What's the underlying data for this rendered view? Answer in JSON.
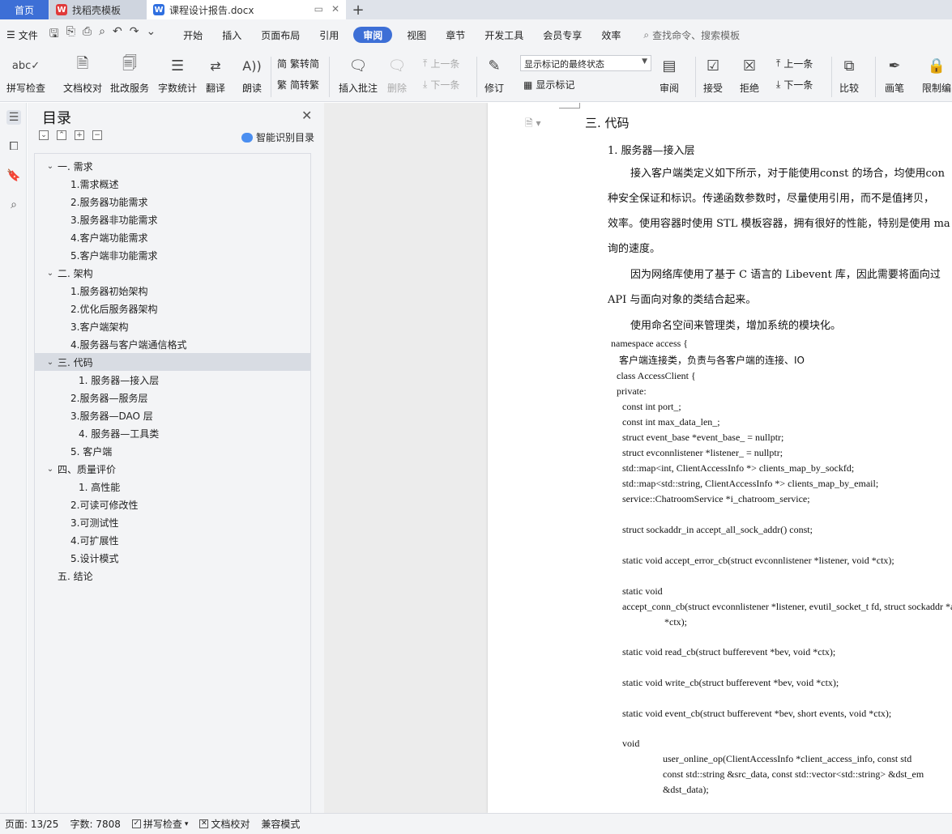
{
  "tabs": {
    "home": "首页",
    "template": "找稻壳模板",
    "doc": "课程设计报告.docx"
  },
  "menu": {
    "file": "文件",
    "items": [
      "开始",
      "插入",
      "页面布局",
      "引用",
      "审阅",
      "视图",
      "章节",
      "开发工具",
      "会员专享",
      "效率"
    ],
    "active_index": 4,
    "search": "查找命令、搜索模板"
  },
  "ribbon": {
    "spell": "拼写检查",
    "doc_check": "文档校对",
    "batch": "批改服务",
    "word_count": "字数统计",
    "translate": "翻译",
    "read_aloud": "朗读",
    "trad_to_simp": "繁转简",
    "simp_to_trad": "简转繁",
    "insert_comment": "插入批注",
    "delete": "删除",
    "prev": "上一条",
    "next": "下一条",
    "revise": "修订",
    "markup_select": "显示标记的最终状态",
    "show_markup": "显示标记",
    "review": "审阅",
    "accept": "接受",
    "reject": "拒绝",
    "prev2": "上一条",
    "next2": "下一条",
    "compare": "比较",
    "pen": "画笔",
    "restrict": "限制编"
  },
  "toc": {
    "title": "目录",
    "smart": "智能识别目录",
    "items": [
      {
        "label": "一. 需求",
        "level": 1,
        "chev": true
      },
      {
        "label": "1.需求概述",
        "level": 2
      },
      {
        "label": "2.服务器功能需求",
        "level": 2
      },
      {
        "label": "3.服务器非功能需求",
        "level": 2
      },
      {
        "label": "4.客户端功能需求",
        "level": 2
      },
      {
        "label": "5.客户端非功能需求",
        "level": 2
      },
      {
        "label": "二. 架构",
        "level": 1,
        "chev": true
      },
      {
        "label": "1.服务器初始架构",
        "level": 2
      },
      {
        "label": "2.优化后服务器架构",
        "level": 2
      },
      {
        "label": "3.客户端架构",
        "level": 2
      },
      {
        "label": "4.服务器与客户端通信格式",
        "level": 2
      },
      {
        "label": "三. 代码",
        "level": 1,
        "chev": true,
        "selected": true
      },
      {
        "label": "1. 服务器—接入层",
        "level": 3
      },
      {
        "label": "2.服务器—服务层",
        "level": 2
      },
      {
        "label": "3.服务器—DAO 层",
        "level": 2
      },
      {
        "label": "4. 服务器—工具类",
        "level": 3
      },
      {
        "label": "5. 客户端",
        "level": 2
      },
      {
        "label": "四、质量评价",
        "level": 1,
        "chev": true
      },
      {
        "label": "1. 高性能",
        "level": 3
      },
      {
        "label": "2.可读可修改性",
        "level": 2
      },
      {
        "label": "3.可测试性",
        "level": 2
      },
      {
        "label": "4.可扩展性",
        "level": 2
      },
      {
        "label": "5.设计模式",
        "level": 2
      },
      {
        "label": "五. 结论",
        "level": 0
      }
    ]
  },
  "doc": {
    "h1": "三. 代码",
    "h2": "1. 服务器—接入层",
    "paras": [
      "接入客户端类定义如下所示，对于能使用const 的场合，均使用con",
      "种安全保证和标识。传递函数参数时，尽量使用引用，而不是值拷贝，",
      "效率。使用容器时使用 STL 模板容器，拥有很好的性能，特别是使用 ma",
      "询的速度。",
      "因为网络库使用了基于 C 语言的 Libevent 库，因此需要将面向过",
      "API 与面向对象的类结合起来。",
      "使用命名空间来管理类，增加系统的模块化。"
    ],
    "code": [
      "namespace access {",
      "客户端连接类，负责与各客户端的连接、IO",
      "class AccessClient {",
      "private:",
      "const int port_;",
      "const int max_data_len_;",
      "struct event_base *event_base_ = nullptr;",
      "struct evconnlistener *listener_ = nullptr;",
      "std::map<int, ClientAccessInfo *> clients_map_by_sockfd;",
      "std::map<std::string, ClientAccessInfo *> clients_map_by_email;",
      "service::ChatroomService *i_chatroom_service;",
      "struct sockaddr_in accept_all_sock_addr() const;",
      "static void accept_error_cb(struct evconnlistener *listener, void *ctx);",
      "static void",
      "accept_conn_cb(struct evconnlistener *listener, evutil_socket_t fd, struct sockaddr *addr",
      "*ctx);",
      "static void read_cb(struct bufferevent *bev, void *ctx);",
      "static void write_cb(struct bufferevent *bev, void *ctx);",
      "static void event_cb(struct bufferevent *bev, short events, void *ctx);",
      "void",
      "user_online_op(ClientAccessInfo      *client_access_info,    const    std",
      "const   std::string    &src_data,   const   std::vector<std::string>  &dst_em",
      "&dst_data);"
    ]
  },
  "status": {
    "page": "页面: 13/25",
    "words": "字数: 7808",
    "spell": "拼写检查",
    "doc_check": "文档校对",
    "compat": "兼容模式"
  },
  "colors": {
    "accent": "#3d6fd6",
    "tabbar": "#dfe3ea",
    "chrome": "#f3f4f6"
  }
}
